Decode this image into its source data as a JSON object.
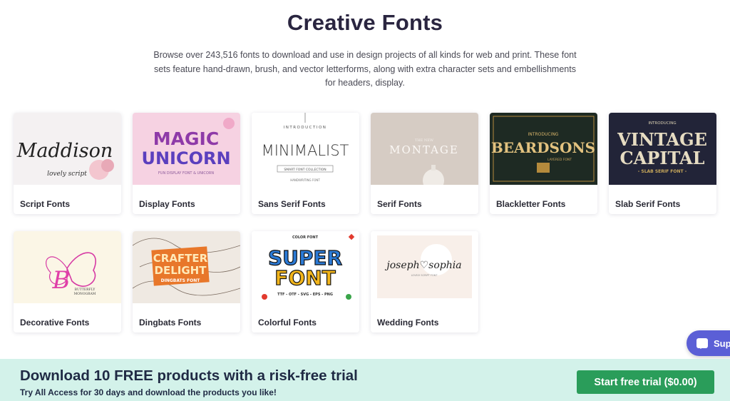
{
  "header": {
    "title": "Creative Fonts",
    "description": "Browse over 243,516 fonts to download and use in design projects of all kinds for web and print. These font sets feature hand-drawn, brush, and vector letterforms, along with extra character sets and embellishments for headers, display."
  },
  "categories": [
    {
      "label": "Script Fonts",
      "thumb_text": "Maddison",
      "thumb_sub": "lovely script"
    },
    {
      "label": "Display Fonts",
      "thumb_text": "MAGIC",
      "thumb_text2": "UNICORN",
      "thumb_sub": "FUN DISPLAY FONT & UNICORN"
    },
    {
      "label": "Sans Serif Fonts",
      "thumb_top": "INTRODUCTION",
      "thumb_text": "MINIMALIST",
      "thumb_sub": "SMART FONT COLLECTION",
      "thumb_sub2": "HANDWRITING FONT"
    },
    {
      "label": "Serif Fonts",
      "thumb_top": "THE NEW",
      "thumb_text": "MONTAGE"
    },
    {
      "label": "Blackletter Fonts",
      "thumb_top": "INTRODUCING",
      "thumb_text": "BEARDSONS",
      "thumb_sub": "LAYERED FONT"
    },
    {
      "label": "Slab Serif Fonts",
      "thumb_top": "INTRODUCING",
      "thumb_text": "VINTAGE",
      "thumb_text2": "CAPITAL",
      "thumb_sub": "- SLAB SERIF FONT -"
    },
    {
      "label": "Decorative Fonts",
      "thumb_text": "B",
      "thumb_sub": "BUTTERFLY",
      "thumb_sub2": "MONOGRAM"
    },
    {
      "label": "Dingbats Fonts",
      "thumb_text": "CRAFTER",
      "thumb_text2": "DELIGHT",
      "thumb_sub": "DINGBATS FONT"
    },
    {
      "label": "Colorful Fonts",
      "thumb_top": "COLOR FONT",
      "thumb_text": "SUPER",
      "thumb_text2": "FONT",
      "thumb_sub": "TTF - OTF - SVG - EPS - PNG"
    },
    {
      "label": "Wedding Fonts",
      "thumb_text": "joseph♡sophia",
      "thumb_sub": "LOVELY SCRIPT FONT"
    }
  ],
  "chat": {
    "label": "Sup"
  },
  "promo": {
    "title": "Download 10 FREE products with a risk-free trial",
    "subtitle": "Try All Access for 30 days and download the products you like!",
    "button_label": "Start free trial ($0.00)"
  },
  "colors": {
    "accent": "#2a9d5a",
    "promo_bg": "#d3f2ea",
    "chat_bg": "#5b5fd6"
  }
}
